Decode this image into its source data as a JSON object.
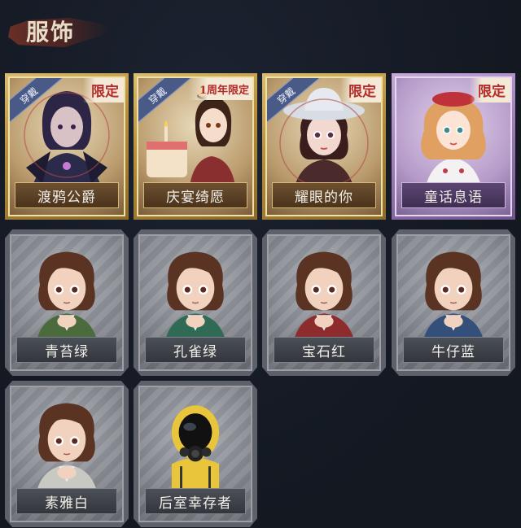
{
  "header": {
    "title": "服饰"
  },
  "tags": {
    "equipped": "穿戴"
  },
  "cards": [
    {
      "name": "渡鸦公爵",
      "frame": "gold",
      "equipped": true,
      "limited": "限定",
      "portrait": "raven-duke-portrait"
    },
    {
      "name": "庆宴绮愿",
      "frame": "gold",
      "equipped": true,
      "limited": "1周年限定",
      "portrait": "celebration-cake-portrait"
    },
    {
      "name": "耀眼的你",
      "frame": "gold",
      "equipped": true,
      "limited": "限定",
      "portrait": "cowgirl-hat-portrait"
    },
    {
      "name": "童话息语",
      "frame": "violet",
      "equipped": false,
      "limited": "限定",
      "portrait": "fairytale-girl-portrait"
    },
    {
      "name": "青苔绿",
      "frame": "gray",
      "equipped": false,
      "limited": "",
      "portrait": "girl-green-cardigan",
      "accent": "#4c6b3c"
    },
    {
      "name": "孔雀绿",
      "frame": "gray",
      "equipped": false,
      "limited": "",
      "portrait": "girl-peacock-cardigan",
      "accent": "#2f6a55"
    },
    {
      "name": "宝石红",
      "frame": "gray",
      "equipped": false,
      "limited": "",
      "portrait": "girl-ruby-cardigan",
      "accent": "#8d2c2c"
    },
    {
      "name": "牛仔蓝",
      "frame": "gray",
      "equipped": false,
      "limited": "",
      "portrait": "girl-denim-cardigan",
      "accent": "#34507a"
    },
    {
      "name": "素雅白",
      "frame": "gray",
      "equipped": false,
      "limited": "",
      "portrait": "girl-white-cardigan",
      "accent": "#c9c9c4"
    },
    {
      "name": "后室幸存者",
      "frame": "gray",
      "equipped": false,
      "limited": "",
      "portrait": "hazmat-gasmask-portrait",
      "accent": "#e8c53a"
    }
  ]
}
